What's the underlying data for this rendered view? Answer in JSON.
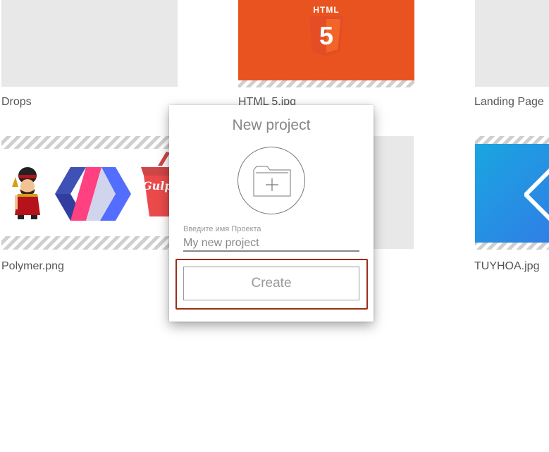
{
  "projects": [
    {
      "name": "Drops"
    },
    {
      "name": "HTML 5.jpg",
      "badge_text": "HTML",
      "badge_numeral": "5"
    },
    {
      "name": "Landing Page"
    },
    {
      "name": "Polymer.png",
      "logo_text": "Gulp"
    },
    {
      "name": ""
    },
    {
      "name": "TUYHOA.jpg"
    }
  ],
  "modal": {
    "title": "New project",
    "icon": "folder-plus-icon",
    "field_label": "Введите имя Проекта",
    "field_placeholder": "My new project",
    "create_label": "Create"
  },
  "colors": {
    "html5_orange": "#e9531f",
    "html5_shield": "#e44d26",
    "tuyhoa_blue": "#1f93df",
    "focus_ring": "#9a2f14"
  }
}
